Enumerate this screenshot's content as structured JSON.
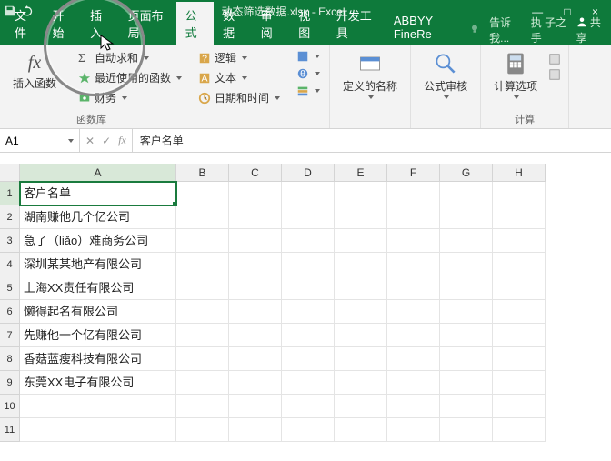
{
  "title": "动态筛选数据.xlsx - Excel",
  "tabs": [
    "文件",
    "开始",
    "插入",
    "页面布局",
    "公式",
    "数据",
    "审阅",
    "视图",
    "开发工具",
    "ABBYY FineRe"
  ],
  "tellme": "告诉我...",
  "signin": "执 子之手",
  "share": "共享",
  "ribbon": {
    "fx_label": "插入函数",
    "col1": [
      "自动求和",
      "最近使用的函数",
      "财务"
    ],
    "col2": [
      "逻辑",
      "文本",
      "日期和时间"
    ],
    "group1_label": "函数库",
    "define": "定义的名称",
    "audit": "公式审核",
    "calc": "计算选项",
    "group_calc": "计算"
  },
  "namebox": "A1",
  "formula_value": "客户名单",
  "cols": [
    "A",
    "B",
    "C",
    "D",
    "E",
    "F",
    "G",
    "H"
  ],
  "rows": [
    "1",
    "2",
    "3",
    "4",
    "5",
    "6",
    "7",
    "8",
    "9",
    "10",
    "11"
  ],
  "data_a": [
    "客户名单",
    "湖南赚他几个亿公司",
    "急了（liǎo）难商务公司",
    "深圳某某地产有限公司",
    "上海XX责任有限公司",
    "懒得起名有限公司",
    "先赚他一个亿有限公司",
    "香菇蓝瘦科技有限公司",
    "东莞XX电子有限公司",
    "",
    ""
  ]
}
